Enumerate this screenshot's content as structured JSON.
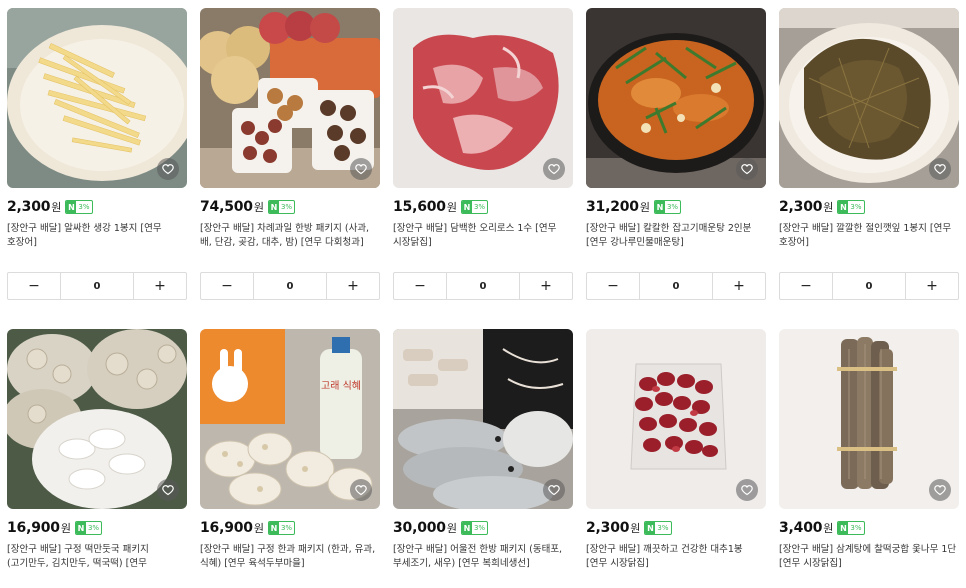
{
  "products": [
    {
      "price": "2,300",
      "currency": "원",
      "badge_n": "N",
      "badge_pct": "3%",
      "title": "[장안구 배달] 알싸한 생강 1봉지 [연무 호장어]",
      "qty": "0",
      "minus": "−",
      "plus": "+"
    },
    {
      "price": "74,500",
      "currency": "원",
      "badge_n": "N",
      "badge_pct": "3%",
      "title": "[장안구 배달] 차례과일 한방 패키지 (사과, 배, 단감, 곶감, 대추, 밤) [연무 다회청과]",
      "qty": "0",
      "minus": "−",
      "plus": "+"
    },
    {
      "price": "15,600",
      "currency": "원",
      "badge_n": "N",
      "badge_pct": "3%",
      "title": "[장안구 배달] 담백한 오리로스 1수 [연무 시장닭집]",
      "qty": "0",
      "minus": "−",
      "plus": "+"
    },
    {
      "price": "31,200",
      "currency": "원",
      "badge_n": "N",
      "badge_pct": "3%",
      "title": "[장안구 배달] 칼칼한 잡고기매운탕 2인분 [연무 강나루민물매운탕]",
      "qty": "0",
      "minus": "−",
      "plus": "+"
    },
    {
      "price": "2,300",
      "currency": "원",
      "badge_n": "N",
      "badge_pct": "3%",
      "title": "[장안구 배달] 깔깔한 절인깻잎 1봉지 [연무 호장어]",
      "qty": "0",
      "minus": "−",
      "plus": "+"
    },
    {
      "price": "16,900",
      "currency": "원",
      "badge_n": "N",
      "badge_pct": "3%",
      "title": "[장안구 배달] 구정 떡만둣국 패키지 (고기만두, 김치만두, 떡국떡) [연무 육석두부마을]"
    },
    {
      "price": "16,900",
      "currency": "원",
      "badge_n": "N",
      "badge_pct": "3%",
      "title": "[장안구 배달] 구정 한과 패키지 (한과, 유과, 식혜) [연무 육석두부마을]"
    },
    {
      "price": "30,000",
      "currency": "원",
      "badge_n": "N",
      "badge_pct": "3%",
      "title": "[장안구 배달] 어울전 한방 패키지 (동태포, 부세조기, 새우) [연무 복희네생선]"
    },
    {
      "price": "2,300",
      "currency": "원",
      "badge_n": "N",
      "badge_pct": "3%",
      "title": "[장안구 배달] 깨끗하고 건강한 대추1봉 [연무 시장닭집]"
    },
    {
      "price": "3,400",
      "currency": "원",
      "badge_n": "N",
      "badge_pct": "3%",
      "title": "[장안구 배달] 삼계탕에 찰떡궁합 옻나무 1단 [연무 시장닭집]"
    }
  ],
  "thumb_label_row2_2": "고래 식혜",
  "colors": {
    "accent": "#3dbb5b",
    "heart_bg": "#5a5a5a"
  },
  "icons": {
    "like": "heart-icon",
    "minus": "minus-icon",
    "plus": "plus-icon"
  }
}
